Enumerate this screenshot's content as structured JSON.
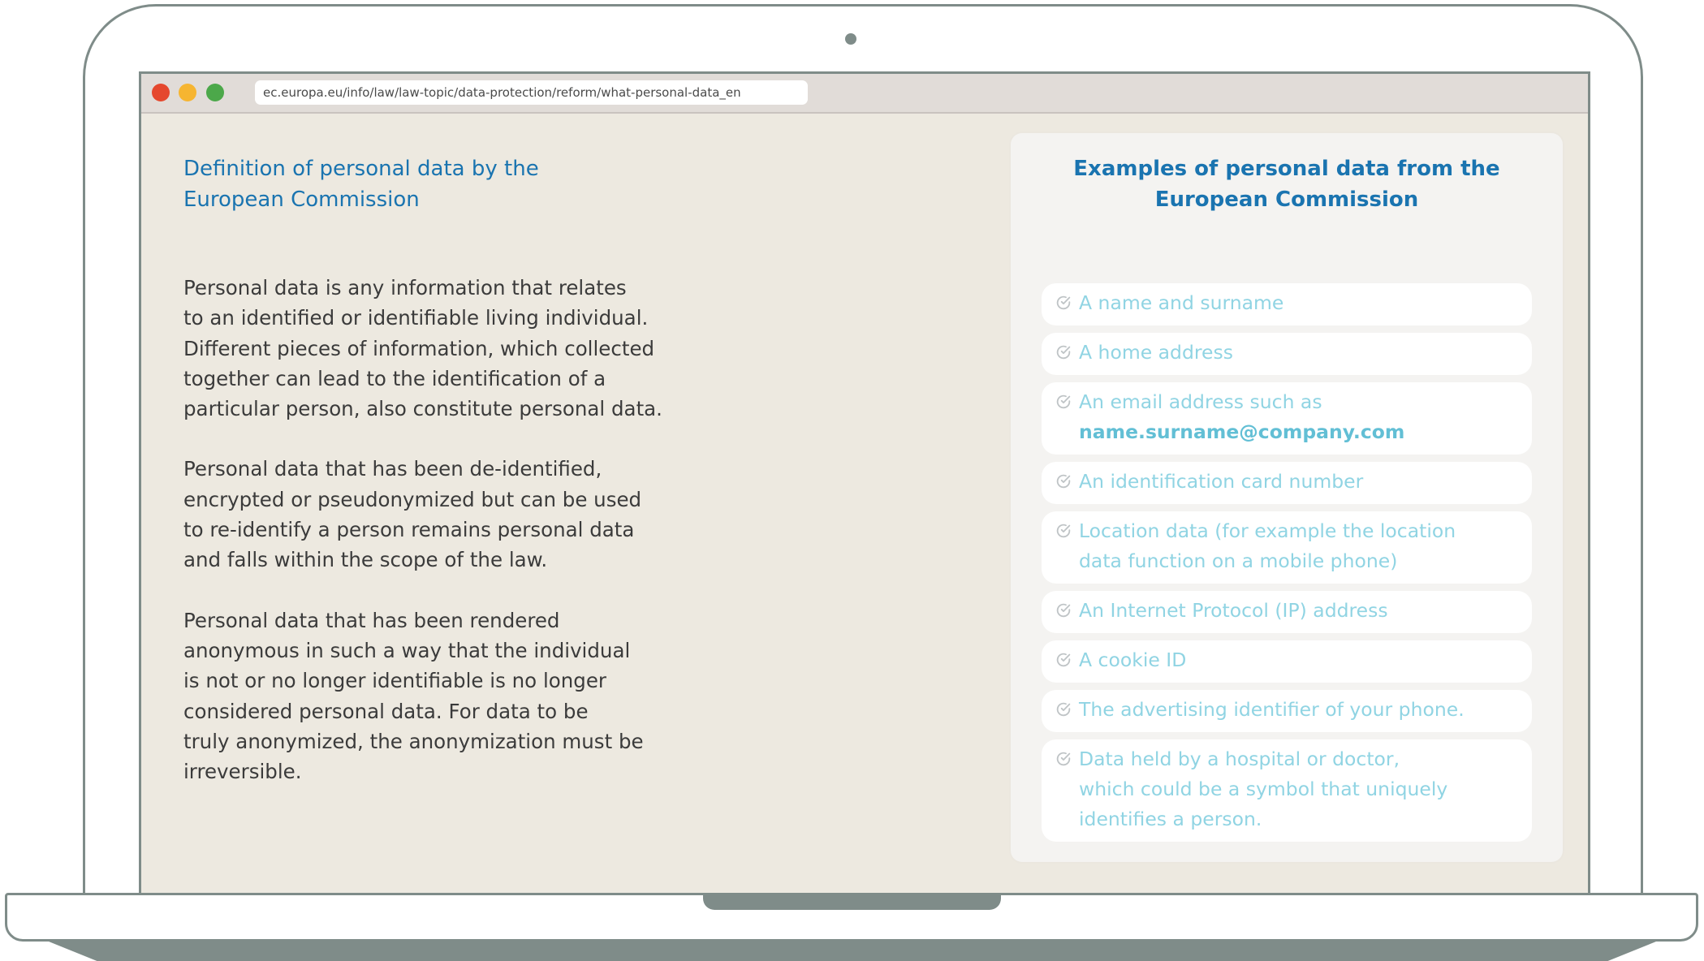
{
  "browser": {
    "url": "ec.europa.eu/info/law/law-topic/data-protection/reform/what-personal-data_en"
  },
  "left": {
    "title": "Definition of personal data by the\nEuropean Commission",
    "paragraphs": [
      "Personal data is any information that relates\nto an identified or identifiable living individual.\nDifferent pieces of information, which collected\ntogether can lead to the identification of a\nparticular person, also constitute personal data.",
      "Personal data that has been de-identified,\nencrypted or pseudonymized but can be used\nto re-identify a person remains personal data\nand falls within the scope of the law.",
      "Personal data that has been rendered\nanonymous in such a way that the individual\nis not or no longer identifiable is no longer\nconsidered personal data. For data to be\ntruly anonymized, the anonymization must be\nirreversible."
    ]
  },
  "card": {
    "title": "Examples of personal data from the\nEuropean Commission",
    "items": [
      "A name and surname",
      "A home address",
      "An email address such as",
      "An identification card number",
      "Location data (for example the location",
      "An Internet Protocol (IP) address",
      "A cookie ID",
      "The advertising identifier of your phone.",
      "Data held by a hospital or doctor,"
    ],
    "item_continuations": {
      "email_example": "name.surname@company.com",
      "location_line2": "data function on a mobile phone)",
      "hospital_line2": "which could be a symbol that uniquely",
      "hospital_line3": "identifies a person."
    },
    "icon": "check-circle-icon"
  },
  "colors": {
    "heading": "#1a74b0",
    "item_text": "#90d4e3",
    "page_bg": "#ede9e0",
    "frame": "#7f8c89"
  }
}
